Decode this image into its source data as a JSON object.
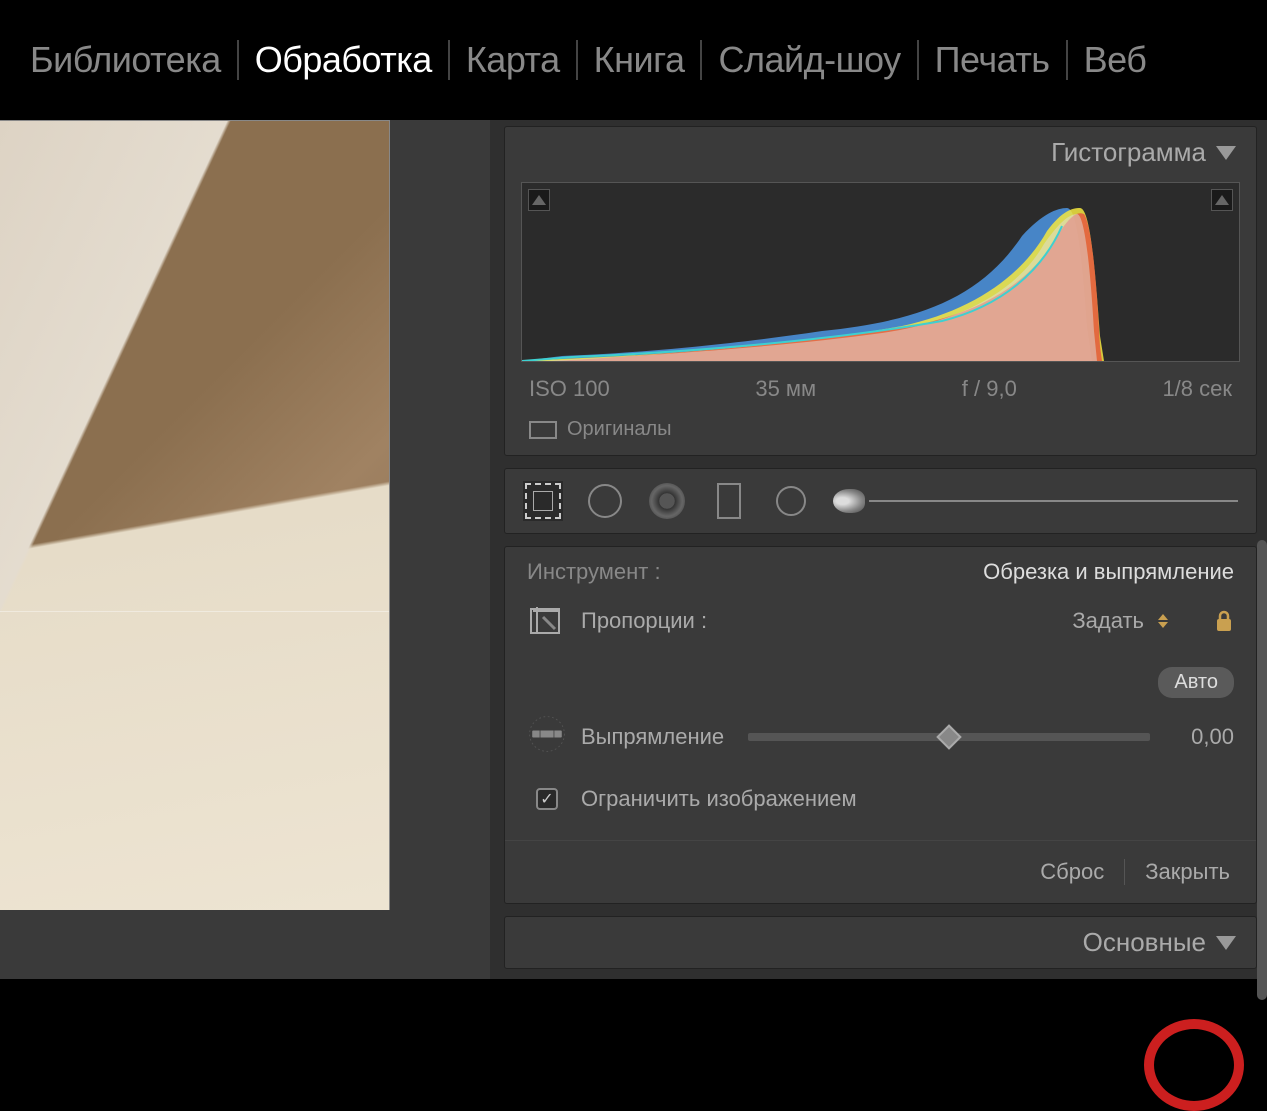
{
  "modules": {
    "library": "Библиотека",
    "develop": "Обработка",
    "map": "Карта",
    "book": "Книга",
    "slideshow": "Слайд-шоу",
    "print": "Печать",
    "web": "Веб"
  },
  "histogram": {
    "title": "Гистограмма",
    "exif": {
      "iso": "ISO 100",
      "focal": "35 мм",
      "aperture": "f / 9,0",
      "shutter": "1/8 сек"
    },
    "originals": "Оригиналы"
  },
  "tool": {
    "label": "Инструмент :",
    "name": "Обрезка и выпрямление",
    "aspect_label": "Пропорции :",
    "aspect_value": "Задать",
    "auto": "Авто",
    "straighten_label": "Выпрямление",
    "straighten_value": "0,00",
    "constrain": "Ограничить изображением",
    "reset": "Сброс",
    "close": "Закрыть"
  },
  "basic_panel": "Основные"
}
